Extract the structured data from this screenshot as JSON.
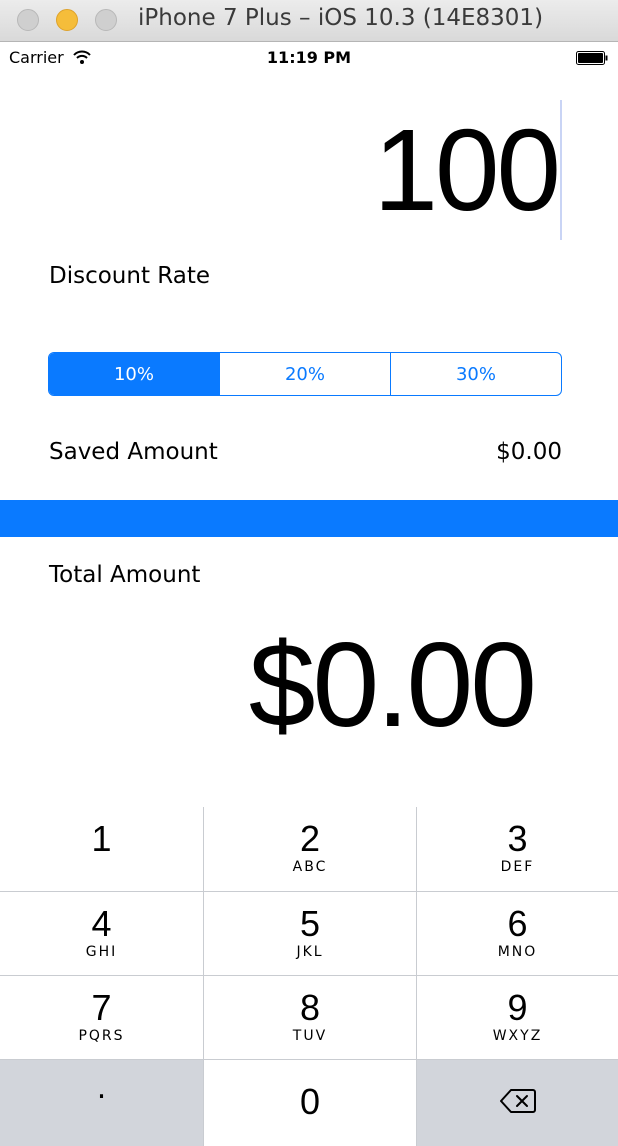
{
  "window": {
    "title": "iPhone 7 Plus – iOS 10.3 (14E8301)"
  },
  "status_bar": {
    "carrier": "Carrier",
    "time": "11:19 PM",
    "icons": [
      "wifi-icon",
      "battery-icon"
    ]
  },
  "amount_input": {
    "value": "100"
  },
  "discount": {
    "label": "Discount Rate",
    "options": [
      "10%",
      "20%",
      "30%"
    ],
    "selected_index": 0
  },
  "saved": {
    "label": "Saved Amount",
    "value": "$0.00"
  },
  "total": {
    "label": "Total Amount",
    "value": "$0.00"
  },
  "keypad": {
    "keys": [
      {
        "num": "1",
        "letters": ""
      },
      {
        "num": "2",
        "letters": "ABC"
      },
      {
        "num": "3",
        "letters": "DEF"
      },
      {
        "num": "4",
        "letters": "GHI"
      },
      {
        "num": "5",
        "letters": "JKL"
      },
      {
        "num": "6",
        "letters": "MNO"
      },
      {
        "num": "7",
        "letters": "PQRS"
      },
      {
        "num": "8",
        "letters": "TUV"
      },
      {
        "num": "9",
        "letters": "WXYZ"
      }
    ],
    "decimal": ".",
    "zero": "0",
    "delete_icon": "backspace-icon"
  },
  "colors": {
    "accent": "#0a7aff",
    "keypad_gray": "#d2d5db"
  }
}
